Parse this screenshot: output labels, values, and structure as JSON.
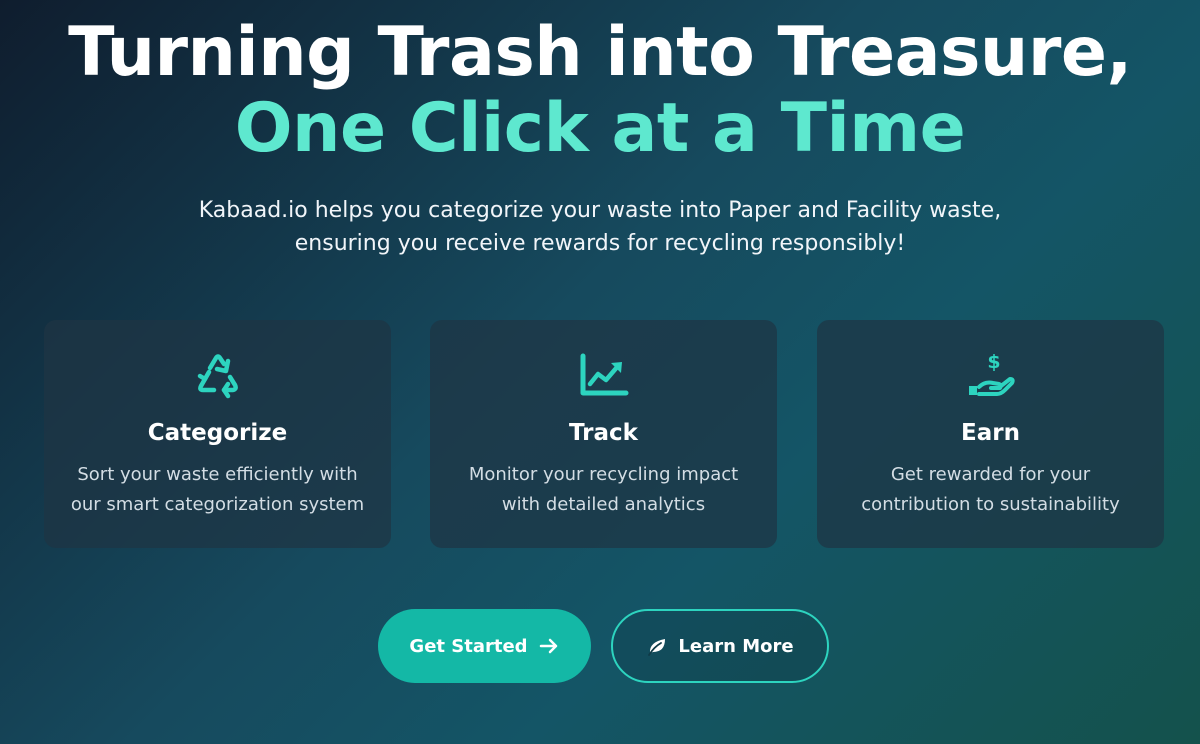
{
  "hero": {
    "title_line1": "Turning Trash into Treasure,",
    "title_line2": "One Click at a Time",
    "subtitle_line1": "Kabaad.io helps you categorize your waste into Paper and Facility waste,",
    "subtitle_line2": "ensuring you receive rewards for recycling responsibly!"
  },
  "features": [
    {
      "icon": "recycle-icon",
      "title": "Categorize",
      "desc_line1": "Sort your waste efficiently with",
      "desc_line2": "our smart categorization system"
    },
    {
      "icon": "chart-line-icon",
      "title": "Track",
      "desc_line1": "Monitor your recycling impact",
      "desc_line2": "with detailed analytics"
    },
    {
      "icon": "hand-dollar-icon",
      "title": "Earn",
      "desc_line1": "Get rewarded for your",
      "desc_line2": "contribution to sustainability"
    }
  ],
  "actions": {
    "get_started_label": "Get Started",
    "get_started_icon": "arrow-right-icon",
    "learn_more_label": "Learn More",
    "learn_more_icon": "leaf-icon"
  },
  "colors": {
    "accent": "#5ee8cf",
    "icon": "#2dd4bf",
    "button_primary": "#14b8a6",
    "card_bg": "#1e3444"
  }
}
